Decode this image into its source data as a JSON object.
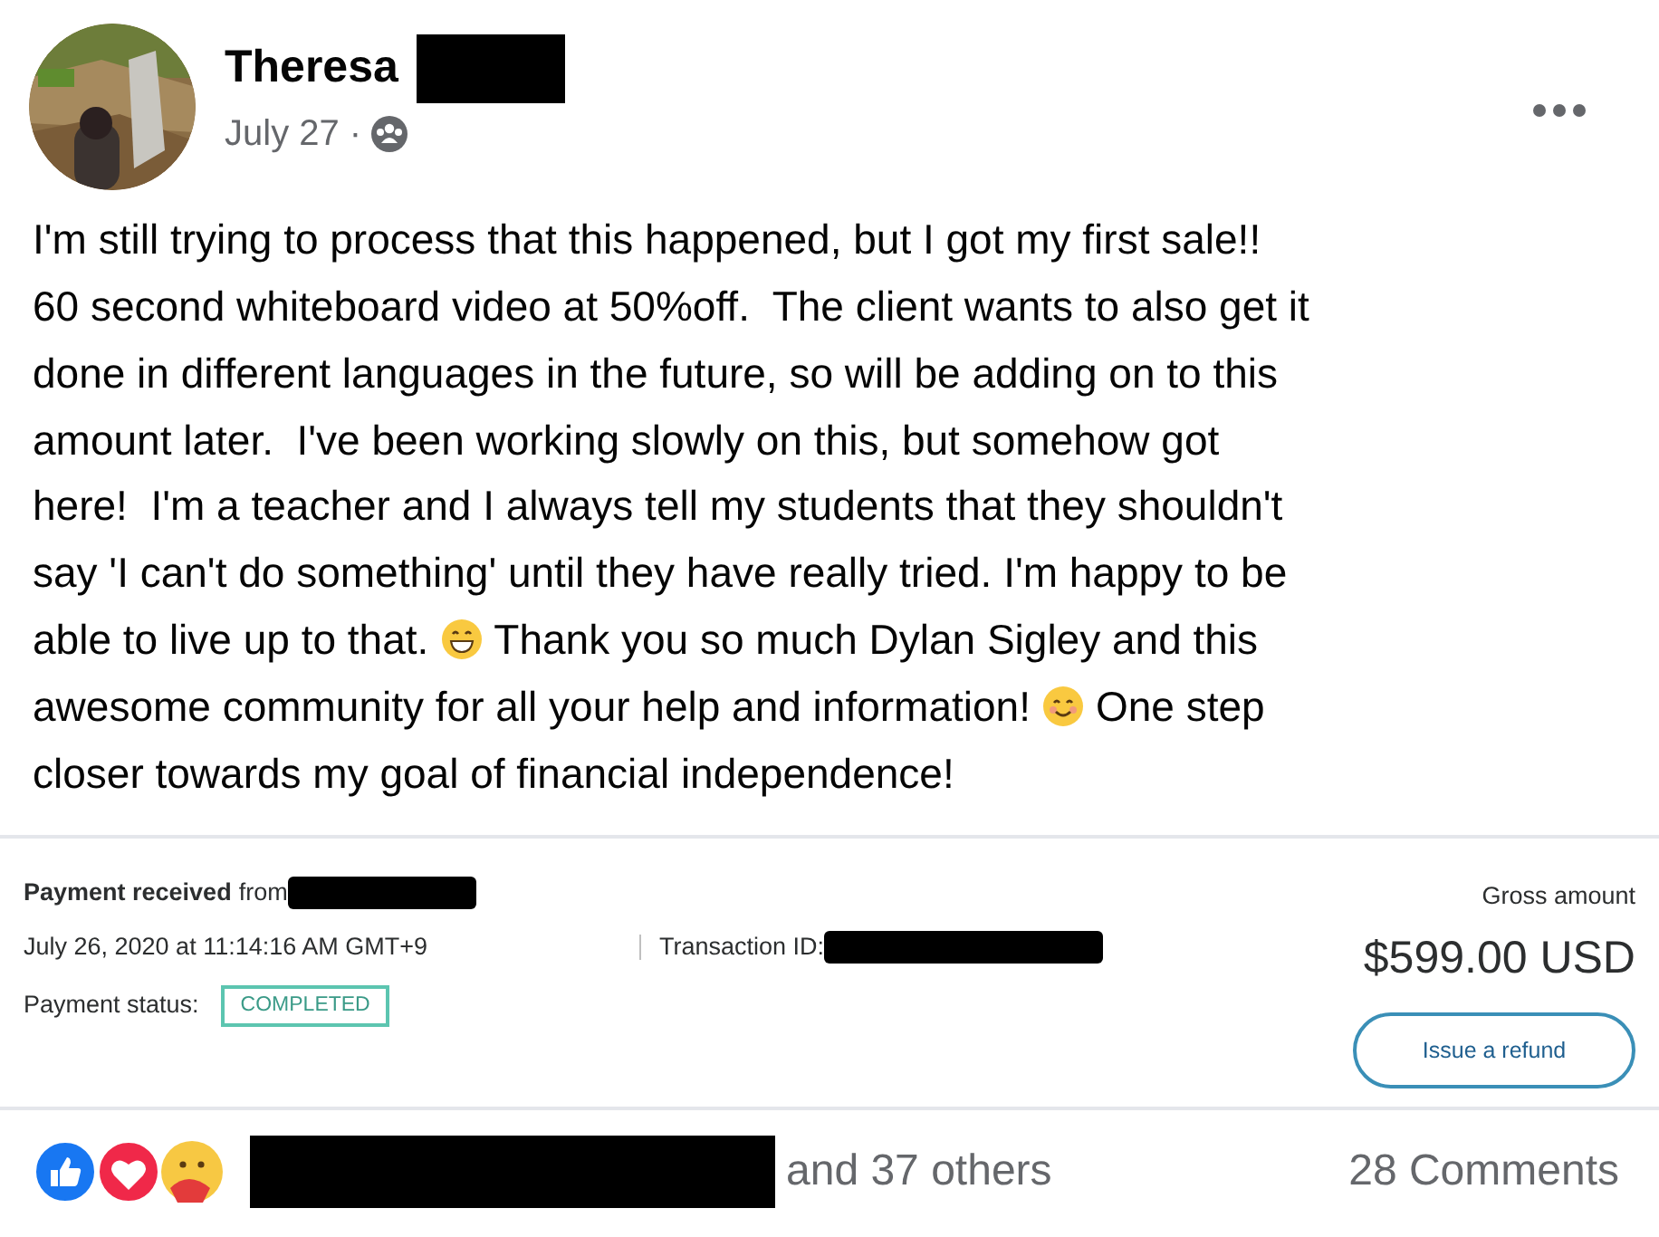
{
  "post": {
    "author": "Theresa",
    "date": "July 27 ·",
    "lines": [
      [
        {
          "kind": "text",
          "text": "I'm still trying to process that this happened, but I got my first sale!!"
        }
      ],
      [
        {
          "kind": "text",
          "text": "60 second whiteboard video at 50%off.  The client wants to also get it"
        }
      ],
      [
        {
          "kind": "text",
          "text": "done in different languages in the future, so will be adding on to this"
        }
      ],
      [
        {
          "kind": "text",
          "text": "amount later.  I've been working slowly on this, but somehow got"
        }
      ],
      [
        {
          "kind": "text",
          "text": "here!  I'm a teacher and I always tell my students that they shouldn't"
        }
      ],
      [
        {
          "kind": "text",
          "text": "say 'I can't do something' until they have really tried. I'm happy to be"
        }
      ],
      [
        {
          "kind": "text",
          "text": "able to live up to that."
        },
        {
          "kind": "grin"
        },
        {
          "kind": "text",
          "text": "Thank you so much Dylan Sigley and this"
        }
      ],
      [
        {
          "kind": "text",
          "text": "awesome community for all your help and information!"
        },
        {
          "kind": "smile"
        },
        {
          "kind": "text",
          "text": "One step"
        }
      ],
      [
        {
          "kind": "text",
          "text": "closer towards my goal of financial independence!"
        }
      ]
    ]
  },
  "payment": {
    "title": "Payment received",
    "from": "from",
    "datetime": "July 26, 2020 at 11:14:16 AM GMT+9",
    "transaction_label": "Transaction ID:",
    "status_label": "Payment status:",
    "status": "COMPLETED",
    "gross_label": "Gross amount",
    "amount": "$599.00 USD",
    "refund_button": "Issue a refund"
  },
  "footer": {
    "others": "and 37 others",
    "comments": "28 Comments"
  }
}
